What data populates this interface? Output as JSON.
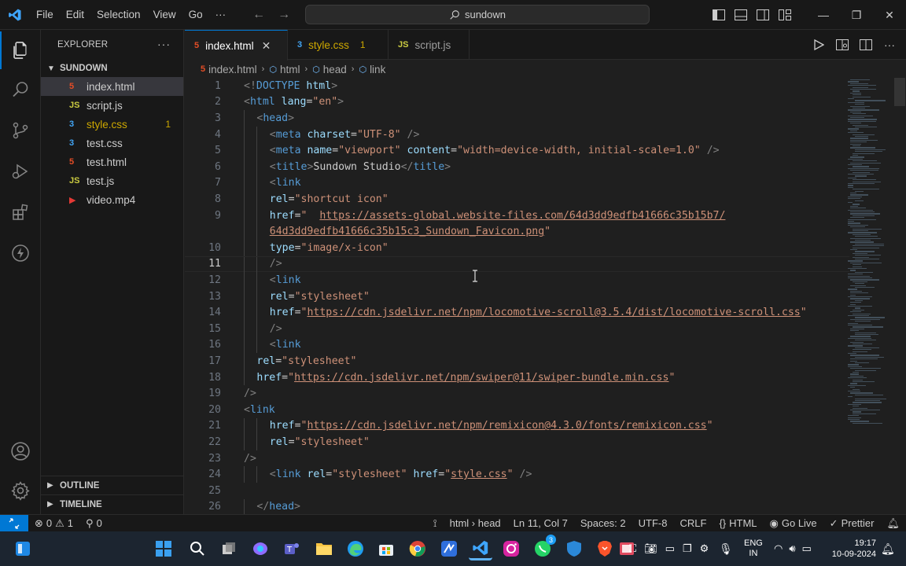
{
  "titlebar": {
    "menu": [
      "File",
      "Edit",
      "Selection",
      "View",
      "Go"
    ],
    "more": "···",
    "search": "sundown"
  },
  "sidebar": {
    "title": "EXPLORER",
    "more": "···",
    "folder": "SUNDOWN",
    "files": [
      {
        "name": "index.html",
        "icon": "html-file-icon",
        "glyph": "5",
        "color": "#e44d26",
        "badge": ""
      },
      {
        "name": "script.js",
        "icon": "js-file-icon",
        "glyph": "JS",
        "color": "#cbcb41",
        "badge": ""
      },
      {
        "name": "style.css",
        "icon": "css-file-icon",
        "glyph": "3",
        "color": "#42a5f5",
        "badge": "1"
      },
      {
        "name": "test.css",
        "icon": "css-file-icon",
        "glyph": "3",
        "color": "#42a5f5",
        "badge": ""
      },
      {
        "name": "test.html",
        "icon": "html-file-icon",
        "glyph": "5",
        "color": "#e44d26",
        "badge": ""
      },
      {
        "name": "test.js",
        "icon": "js-file-icon",
        "glyph": "JS",
        "color": "#cbcb41",
        "badge": ""
      },
      {
        "name": "video.mp4",
        "icon": "video-file-icon",
        "glyph": "▶",
        "color": "#e53935",
        "badge": ""
      }
    ],
    "outline": "OUTLINE",
    "timeline": "TIMELINE"
  },
  "tabs": [
    {
      "label": "index.html",
      "glyph": "5",
      "color": "#e44d26",
      "active": true,
      "badge": ""
    },
    {
      "label": "style.css",
      "glyph": "3",
      "color": "#42a5f5",
      "active": false,
      "badge": "1"
    },
    {
      "label": "script.js",
      "glyph": "JS",
      "color": "#cbcb41",
      "active": false,
      "badge": ""
    }
  ],
  "breadcrumb": [
    "index.html",
    "html",
    "head",
    "link"
  ],
  "editor": {
    "current_line": 11,
    "lines": [
      {
        "n": "1",
        "indent": 0,
        "tokens": [
          [
            "t-tag",
            "<!"
          ],
          [
            "t-name",
            "DOCTYPE"
          ],
          [
            "t-text",
            " "
          ],
          [
            "t-attr",
            "html"
          ],
          [
            "t-tag",
            ">"
          ]
        ]
      },
      {
        "n": "2",
        "indent": 0,
        "tokens": [
          [
            "t-tag",
            "<"
          ],
          [
            "t-name",
            "html"
          ],
          [
            "t-text",
            " "
          ],
          [
            "t-attr",
            "lang"
          ],
          [
            "t-text",
            "="
          ],
          [
            "t-str",
            "\"en\""
          ],
          [
            "t-tag",
            ">"
          ]
        ]
      },
      {
        "n": "3",
        "indent": 1,
        "tokens": [
          [
            "t-tag",
            "<"
          ],
          [
            "t-name",
            "head"
          ],
          [
            "t-tag",
            ">"
          ]
        ]
      },
      {
        "n": "4",
        "indent": 2,
        "tokens": [
          [
            "t-tag",
            "<"
          ],
          [
            "t-name",
            "meta"
          ],
          [
            "t-text",
            " "
          ],
          [
            "t-attr",
            "charset"
          ],
          [
            "t-text",
            "="
          ],
          [
            "t-str",
            "\"UTF-8\""
          ],
          [
            "t-text",
            " "
          ],
          [
            "t-tag",
            "/>"
          ]
        ]
      },
      {
        "n": "5",
        "indent": 2,
        "tokens": [
          [
            "t-tag",
            "<"
          ],
          [
            "t-name",
            "meta"
          ],
          [
            "t-text",
            " "
          ],
          [
            "t-attr",
            "name"
          ],
          [
            "t-text",
            "="
          ],
          [
            "t-str",
            "\"viewport\""
          ],
          [
            "t-text",
            " "
          ],
          [
            "t-attr",
            "content"
          ],
          [
            "t-text",
            "="
          ],
          [
            "t-str",
            "\"width=device-width, initial-scale=1.0\""
          ],
          [
            "t-text",
            " "
          ],
          [
            "t-tag",
            "/>"
          ]
        ]
      },
      {
        "n": "6",
        "indent": 2,
        "tokens": [
          [
            "t-tag",
            "<"
          ],
          [
            "t-name",
            "title"
          ],
          [
            "t-tag",
            ">"
          ],
          [
            "t-text",
            "Sundown Studio"
          ],
          [
            "t-tag",
            "</"
          ],
          [
            "t-name",
            "title"
          ],
          [
            "t-tag",
            ">"
          ]
        ]
      },
      {
        "n": "7",
        "indent": 2,
        "tokens": [
          [
            "t-tag",
            "<"
          ],
          [
            "t-name",
            "link"
          ]
        ]
      },
      {
        "n": "8",
        "indent": 2,
        "tokens": [
          [
            "t-attr",
            "rel"
          ],
          [
            "t-text",
            "="
          ],
          [
            "t-str",
            "\"shortcut icon\""
          ]
        ]
      },
      {
        "n": "9",
        "indent": 2,
        "tokens": [
          [
            "t-attr",
            "href"
          ],
          [
            "t-text",
            "="
          ],
          [
            "t-str",
            "\"  "
          ],
          [
            "t-link",
            "https://assets-global.website-files.com/64d3dd9edfb41666c35b15b7/"
          ]
        ]
      },
      {
        "n": "",
        "indent": 2,
        "tokens": [
          [
            "t-link",
            "64d3dd9edfb41666c35b15c3_Sundown_Favicon.png"
          ],
          [
            "t-str",
            "\""
          ]
        ]
      },
      {
        "n": "10",
        "indent": 2,
        "tokens": [
          [
            "t-attr",
            "type"
          ],
          [
            "t-text",
            "="
          ],
          [
            "t-str",
            "\"image/x-icon\""
          ]
        ]
      },
      {
        "n": "11",
        "indent": 2,
        "tokens": [
          [
            "t-tag",
            "/>"
          ]
        ]
      },
      {
        "n": "12",
        "indent": 2,
        "tokens": [
          [
            "t-tag",
            "<"
          ],
          [
            "t-name",
            "link"
          ]
        ]
      },
      {
        "n": "13",
        "indent": 2,
        "tokens": [
          [
            "t-attr",
            "rel"
          ],
          [
            "t-text",
            "="
          ],
          [
            "t-str",
            "\"stylesheet\""
          ]
        ]
      },
      {
        "n": "14",
        "indent": 2,
        "tokens": [
          [
            "t-attr",
            "href"
          ],
          [
            "t-text",
            "="
          ],
          [
            "t-str",
            "\""
          ],
          [
            "t-link",
            "https://cdn.jsdelivr.net/npm/locomotive-scroll@3.5.4/dist/locomotive-scroll.css"
          ],
          [
            "t-str",
            "\""
          ]
        ]
      },
      {
        "n": "15",
        "indent": 2,
        "tokens": [
          [
            "t-tag",
            "/>"
          ]
        ]
      },
      {
        "n": "16",
        "indent": 2,
        "tokens": [
          [
            "t-tag",
            "<"
          ],
          [
            "t-name",
            "link"
          ]
        ]
      },
      {
        "n": "17",
        "indent": 1,
        "tokens": [
          [
            "t-attr",
            "rel"
          ],
          [
            "t-text",
            "="
          ],
          [
            "t-str",
            "\"stylesheet\""
          ]
        ]
      },
      {
        "n": "18",
        "indent": 1,
        "tokens": [
          [
            "t-attr",
            "href"
          ],
          [
            "t-text",
            "="
          ],
          [
            "t-str",
            "\""
          ],
          [
            "t-link",
            "https://cdn.jsdelivr.net/npm/swiper@11/swiper-bundle.min.css"
          ],
          [
            "t-str",
            "\""
          ]
        ]
      },
      {
        "n": "19",
        "indent": 0,
        "tokens": [
          [
            "t-tag",
            "/>"
          ]
        ]
      },
      {
        "n": "20",
        "indent": 0,
        "tokens": [
          [
            "t-tag",
            "<"
          ],
          [
            "t-name",
            "link"
          ]
        ]
      },
      {
        "n": "21",
        "indent": 2,
        "tokens": [
          [
            "t-attr",
            "href"
          ],
          [
            "t-text",
            "="
          ],
          [
            "t-str",
            "\""
          ],
          [
            "t-link",
            "https://cdn.jsdelivr.net/npm/remixicon@4.3.0/fonts/remixicon.css"
          ],
          [
            "t-str",
            "\""
          ]
        ]
      },
      {
        "n": "22",
        "indent": 2,
        "tokens": [
          [
            "t-attr",
            "rel"
          ],
          [
            "t-text",
            "="
          ],
          [
            "t-str",
            "\"stylesheet\""
          ]
        ]
      },
      {
        "n": "23",
        "indent": 0,
        "tokens": [
          [
            "t-tag",
            "/>"
          ]
        ]
      },
      {
        "n": "24",
        "indent": 2,
        "tokens": [
          [
            "t-tag",
            "<"
          ],
          [
            "t-name",
            "link"
          ],
          [
            "t-text",
            " "
          ],
          [
            "t-attr",
            "rel"
          ],
          [
            "t-text",
            "="
          ],
          [
            "t-str",
            "\"stylesheet\""
          ],
          [
            "t-text",
            " "
          ],
          [
            "t-attr",
            "href"
          ],
          [
            "t-text",
            "="
          ],
          [
            "t-str",
            "\""
          ],
          [
            "t-link",
            "style.css"
          ],
          [
            "t-str",
            "\""
          ],
          [
            "t-text",
            " "
          ],
          [
            "t-tag",
            "/>"
          ]
        ]
      },
      {
        "n": "25",
        "indent": 0,
        "tokens": []
      },
      {
        "n": "26",
        "indent": 1,
        "tokens": [
          [
            "t-tag",
            "</"
          ],
          [
            "t-name",
            "head"
          ],
          [
            "t-tag",
            ">"
          ]
        ]
      }
    ]
  },
  "statusbar": {
    "errors": "0",
    "warnings": "1",
    "ports": "0",
    "breadcrumb": "html › head",
    "position": "Ln 11, Col 7",
    "spaces": "Spaces: 2",
    "encoding": "UTF-8",
    "eol": "CRLF",
    "language": "HTML",
    "golive": "Go Live",
    "prettier": "Prettier"
  },
  "taskbar": {
    "lang_top": "ENG",
    "lang_bottom": "IN",
    "time": "19:17",
    "date": "10-09-2024",
    "whatsapp_badge": "3"
  }
}
